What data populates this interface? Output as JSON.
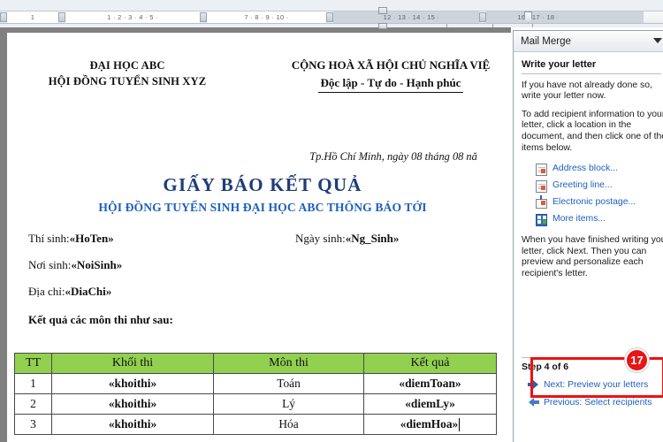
{
  "ruler": {
    "left_marks": [
      "1"
    ],
    "segment_a": "1 · 2 · 3 · 4 · 5 ·",
    "segment_b": "7 · 8 · 9 · 10 ·",
    "segment_c": "12 · 13 · 14 · 15 ·",
    "segment_d": "16 · 17 · 18 ·"
  },
  "document": {
    "header_left": "ĐẠI HỌC ABC\nHỘI ĐỒNG TUYỂN SINH XYZ",
    "header_left_line1": "ĐẠI HỌC ABC",
    "header_left_line2": "HỘI ĐỒNG TUYỂN SINH XYZ",
    "header_right_line1": "CỘNG HOÀ XÃ HỘI CHỦ NGHĨA VIỆ",
    "header_right_line2": "Độc lập - Tự do - Hạnh phúc",
    "date_line": "Tp.Hồ Chí Minh, ngày  08  tháng  08  nă",
    "title_main": "GIẤY  BÁO KẾT QUẢ",
    "title_sub": "HỘI ĐỒNG TUYỂN SINH ĐẠI HỌC ABC THÔNG BÁO TỚI",
    "fields": [
      {
        "label": "Thí sinh:",
        "merge": "«HoTen»",
        "label2": "Ngày sinh:",
        "merge2": "«Ng_Sinh»"
      },
      {
        "label": "Nơi sinh:",
        "merge": "«NoiSinh»",
        "label2": "",
        "merge2": ""
      },
      {
        "label": "Địa chỉ:",
        "merge": "«DiaChi»",
        "label2": "",
        "merge2": ""
      }
    ],
    "results_intro": "Kết quả các môn thi như sau:",
    "table": {
      "headers": [
        "TT",
        "Khối thi",
        "Môn thi",
        "Kết quả"
      ],
      "rows": [
        [
          "1",
          "«khoithi»",
          "Toán",
          "«diemToan»"
        ],
        [
          "2",
          "«khoithi»",
          "Lý",
          "«diemLy»"
        ],
        [
          "3",
          "«khoithi»",
          "Hóa",
          "«diemHoa»"
        ]
      ],
      "header_color": "#92d050"
    }
  },
  "pane": {
    "title": "Mail Merge",
    "section_heading": "Write your letter",
    "paragraph_1": "If you have not already done so, write your letter now.",
    "paragraph_2": "To add recipient information to your letter, click a location in the document, and then click one of the items below.",
    "links": [
      {
        "label": "Address block...",
        "icon": "document-icon"
      },
      {
        "label": "Greeting line...",
        "icon": "document-icon"
      },
      {
        "label": "Electronic postage...",
        "icon": "postage-stamp-icon"
      },
      {
        "label": "More items...",
        "icon": "grid-items-icon"
      }
    ],
    "paragraph_3": "When you have finished writing your letter, click Next. Then you can preview and personalize each recipient's letter.",
    "step_label": "Step 4 of 6",
    "next_link": "Next: Preview your letters",
    "previous_link": "Previous: Select recipients"
  },
  "annotation": {
    "badge_number": "17",
    "highlight_color": "#ee1111"
  }
}
